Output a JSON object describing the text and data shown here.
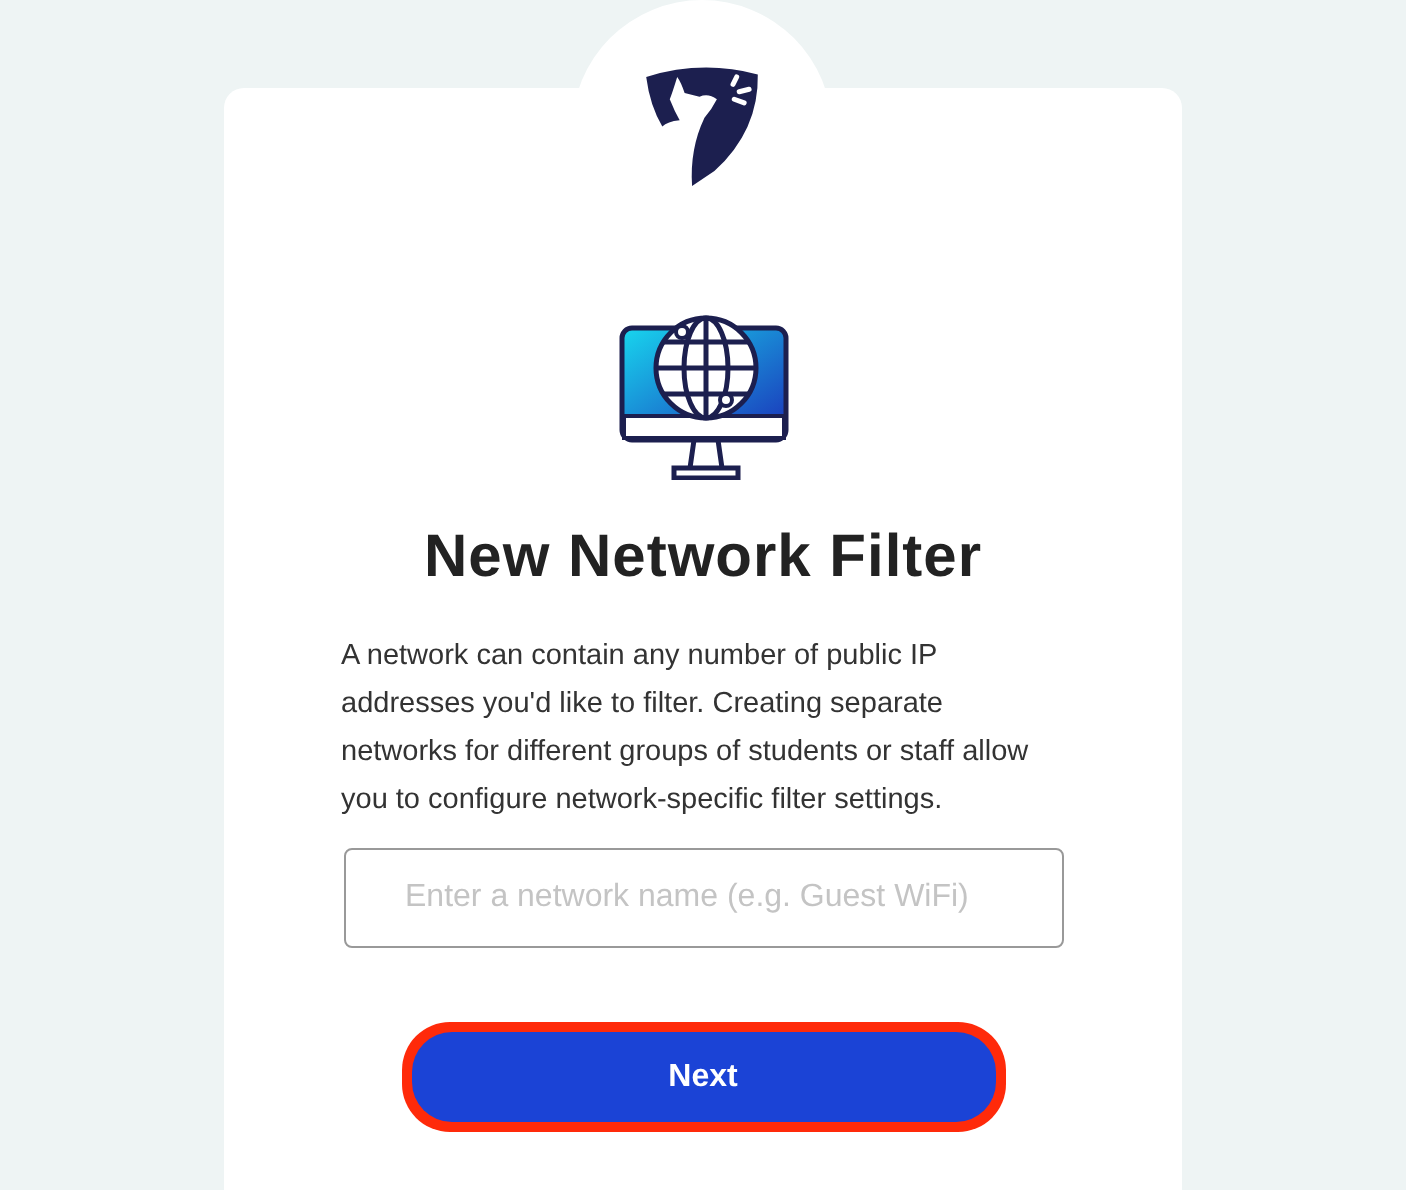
{
  "title": "New Network Filter",
  "description": "A network can contain any number of public IP addresses you'd like to filter. Creating separate networks for different groups of students or staff allow you to configure network-specific filter settings.",
  "name_field": {
    "placeholder": "Enter a network name (e.g. Guest WiFi)"
  },
  "next_button": {
    "label": "Next",
    "highlighted": true
  }
}
